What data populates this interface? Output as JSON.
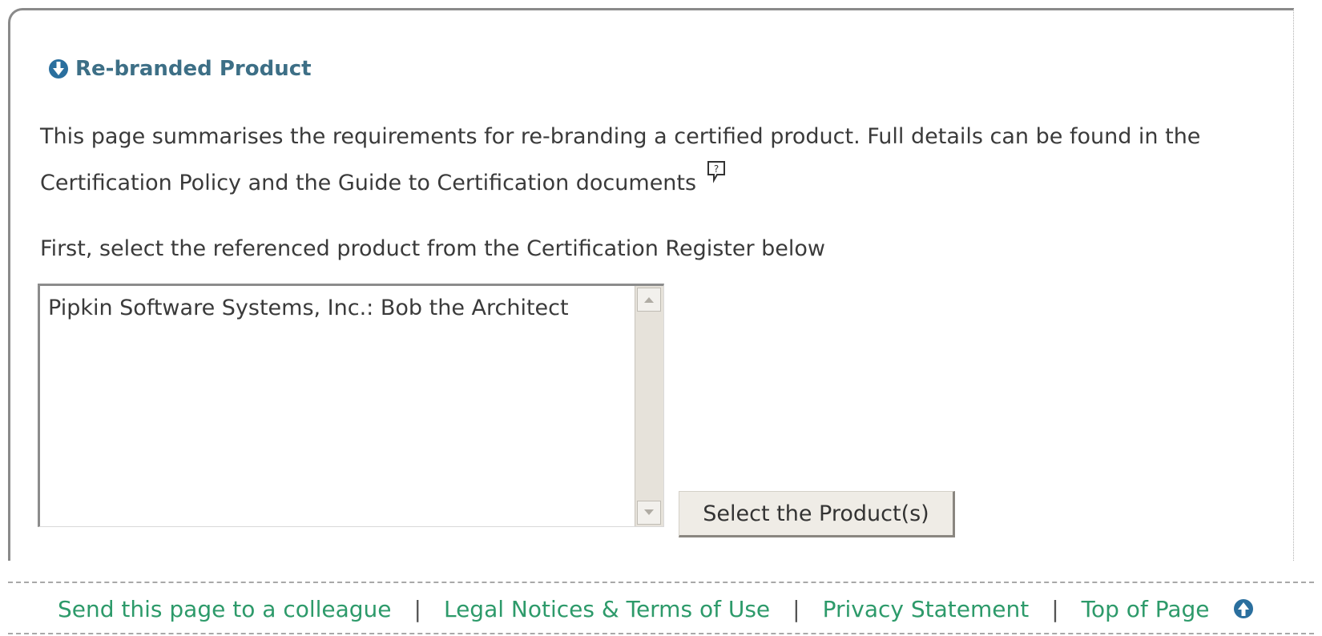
{
  "panel": {
    "title": "Re-branded Product",
    "title_icon": "down-arrow-circle-icon",
    "intro_text": "This page summarises the requirements for re-branding a certified product. Full details can be found in the Certification Policy and the Guide to Certification documents",
    "help_icon": "help-balloon-icon",
    "instruction_text": "First, select the referenced product from the Certification Register below"
  },
  "product_list": {
    "items": [
      "Pipkin Software Systems, Inc.: Bob the Architect"
    ]
  },
  "select_button": {
    "label": "Select the Product(s)"
  },
  "footer": {
    "links": [
      "Send this page to a colleague",
      "Legal Notices & Terms of Use",
      "Privacy Statement",
      "Top of Page"
    ],
    "separator": "|",
    "top_icon": "up-arrow-circle-icon"
  },
  "colors": {
    "title": "#3d6f86",
    "footer_link": "#2d9a6a",
    "icon": "#2a6f9e"
  }
}
